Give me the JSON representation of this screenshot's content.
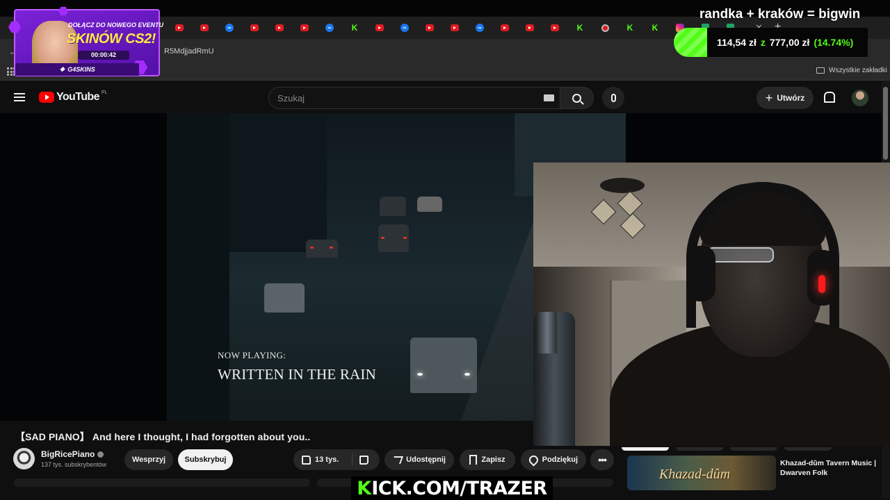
{
  "browser": {
    "tab_favicons": [
      "youtube",
      "youtube",
      "meta",
      "youtube",
      "youtube",
      "youtube",
      "meta",
      "kick",
      "youtube",
      "meta",
      "youtube",
      "youtube",
      "meta",
      "youtube",
      "youtube",
      "youtube",
      "kick",
      "circle",
      "kick",
      "kick",
      "instagram",
      "sheet",
      "sheet"
    ],
    "url_fragment": "R5MdjjadRmU",
    "bookmarks_all": "Wszystkie zakładki"
  },
  "youtube": {
    "logo_text": "YouTube",
    "country_code": "PL",
    "search_placeholder": "Szukaj",
    "create_label": "Utwórz"
  },
  "video": {
    "now_playing": "NOW PLAYING:",
    "song_title": "WRITTEN IN THE RAIN",
    "title": "【SAD PIANO】 And here I thought, I had forgotten about you..",
    "channel_name": "BigRicePiano",
    "subscribers": "137 tys. subskrybentów",
    "support_label": "Wesprzyj",
    "subscribe_label": "Subskrybuj",
    "likes": "13 tys.",
    "share_label": "Udostępnij",
    "save_label": "Zapisz",
    "thanks_label": "Podziękuj"
  },
  "related": {
    "thumb_text": "Khazad-dûm",
    "title": "Khazad-dûm Tavern Music | Dwarven Folk"
  },
  "overlay": {
    "promo_small": "DOŁĄCZ DO NOWEGO EVENTU",
    "promo_big": "SKINÓW CS2!",
    "promo_timer": "00:00:42",
    "promo_brand": "G4SKINS",
    "caption": "randka + kraków = bigwin",
    "balance_now": "114,54 zł",
    "balance_sep": "z",
    "balance_start": "777,00 zł",
    "balance_pct": "(14.74%)",
    "kick_k": "K",
    "kick_rest": "ICK.COM/TRAZER"
  },
  "colors": {
    "kick_green": "#53fc18",
    "youtube_red": "#ff0000",
    "promo_purple": "#7b22d8",
    "promo_yellow": "#ffe84a"
  }
}
